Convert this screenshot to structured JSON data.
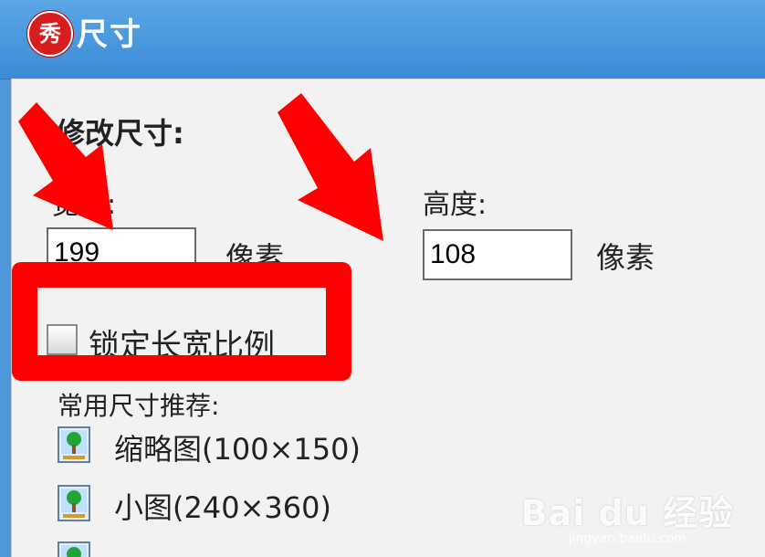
{
  "window": {
    "title": "尺寸",
    "logo_text": "秀"
  },
  "resize": {
    "section_title": "修改尺寸:",
    "width_label": "宽度:",
    "width_value": "199",
    "height_label": "高度:",
    "height_value": "108",
    "unit": "像素",
    "lock_ratio_label": "锁定长宽比例",
    "lock_ratio_checked": false
  },
  "presets": {
    "header": "常用尺寸推荐:",
    "items": [
      {
        "label": "缩略图(100×150)"
      },
      {
        "label": "小图(240×360)"
      }
    ]
  },
  "annotations": {
    "highlight_color": "#ff0000",
    "arrow_color": "#ff0000"
  },
  "watermark": {
    "brand": "Bai du 经验",
    "url": "jingyan.baidu.com"
  }
}
